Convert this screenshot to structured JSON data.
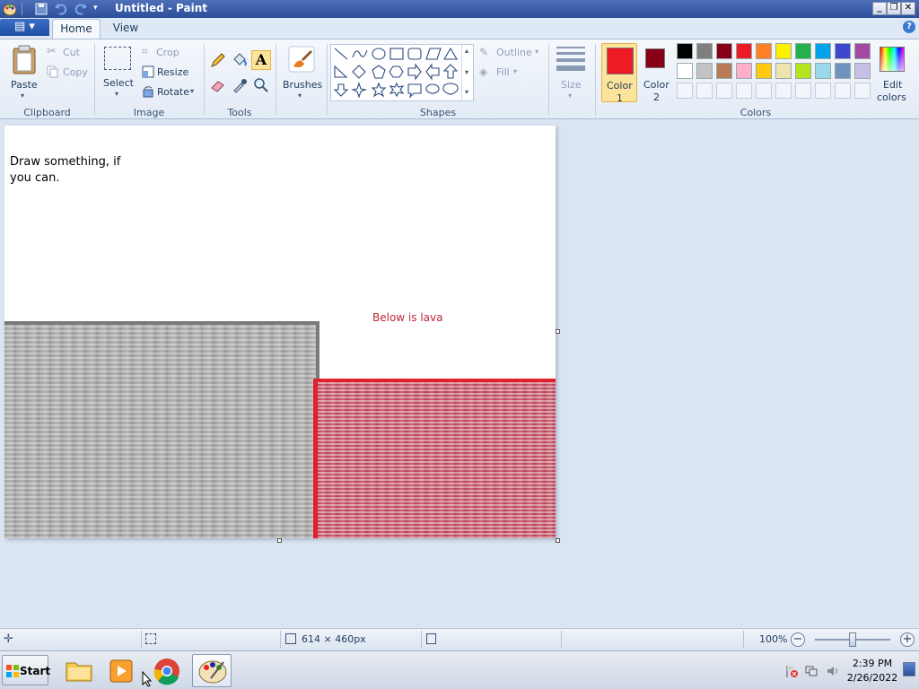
{
  "window": {
    "title": "Untitled - Paint",
    "minimize_glyph": "_",
    "restore_glyph": "❐",
    "close_glyph": "✕"
  },
  "tabs": {
    "home": "Home",
    "view": "View",
    "help_glyph": "?"
  },
  "clipboard": {
    "paste": "Paste",
    "cut": "Cut",
    "copy": "Copy",
    "group": "Clipboard"
  },
  "image": {
    "select": "Select",
    "crop": "Crop",
    "resize": "Resize",
    "rotate": "Rotate",
    "group": "Image"
  },
  "tools": {
    "group": "Tools",
    "text_glyph": "A"
  },
  "brushes": {
    "label": "Brushes"
  },
  "shapes": {
    "group": "Shapes",
    "outline": "Outline",
    "fill": "Fill"
  },
  "size": {
    "label": "Size"
  },
  "colors": {
    "group": "Colors",
    "color1_label_line1": "Color",
    "color1_label_line2": "1",
    "color2_label_line1": "Color",
    "color2_label_line2": "2",
    "edit_label_line1": "Edit",
    "edit_label_line2": "colors",
    "color1": "#ed1c24",
    "color2": "#880015",
    "palette_row1": [
      "#000000",
      "#7f7f7f",
      "#880015",
      "#ed1c24",
      "#ff7f27",
      "#fff200",
      "#22b14c",
      "#00a2e8",
      "#3f48cc",
      "#a349a4"
    ],
    "palette_row2": [
      "#ffffff",
      "#c3c3c3",
      "#b97a57",
      "#ffaec9",
      "#ffc90e",
      "#efe4b0",
      "#b5e61d",
      "#99d9ea",
      "#7092be",
      "#c8bfe7"
    ]
  },
  "canvas": {
    "text_note": "Draw something, if you can.",
    "lava_label": "Below is lava"
  },
  "status": {
    "dimensions": "614 × 460px",
    "zoom": "100%",
    "zoom_out_glyph": "−",
    "zoom_in_glyph": "+"
  },
  "taskbar": {
    "start": "Start",
    "time": "2:39 PM",
    "date": "2/26/2022"
  }
}
